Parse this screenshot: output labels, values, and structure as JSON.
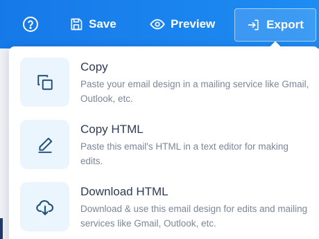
{
  "toolbar": {
    "help_icon": "question-circle-icon",
    "save_label": "Save",
    "save_icon": "floppy-disk-icon",
    "preview_label": "Preview",
    "preview_icon": "eye-icon",
    "export_label": "Export",
    "export_icon": "sign-in-arrow-icon"
  },
  "export_menu": {
    "options": [
      {
        "title": "Copy",
        "description": "Paste your email design in a mailing service like Gmail, Outlook, etc.",
        "icon": "copy-icon"
      },
      {
        "title": "Copy HTML",
        "description": "Paste this email's HTML in a text editor for making edits.",
        "icon": "pencil-icon"
      },
      {
        "title": "Download HTML",
        "description": "Download & use this email design for edits and mailing services like Gmail, Outlook, etc.",
        "icon": "cloud-download-icon"
      }
    ]
  },
  "colors": {
    "toolbar_blue": "#1679e8",
    "icon_tile": "#ebf5fd",
    "icon_stroke": "#1b4f7a",
    "title_text": "#2b3b55",
    "desc_text": "#7a8699"
  }
}
